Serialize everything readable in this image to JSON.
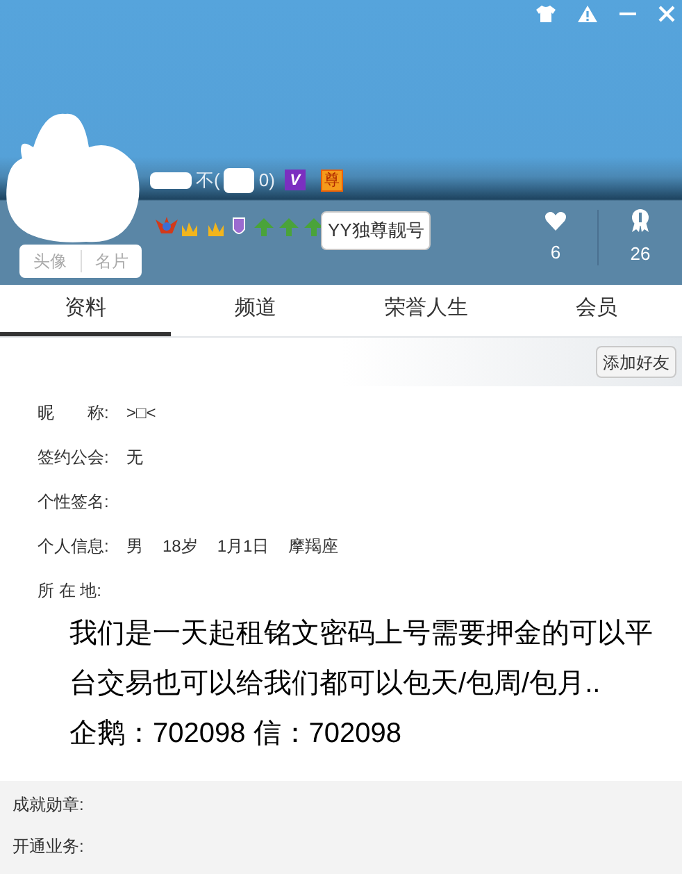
{
  "profile": {
    "name_fragments": [
      "不(",
      "0)"
    ],
    "vip_badge": "V",
    "honor_badge": "尊",
    "tooltip": "YY独尊靓号",
    "avatar_buttons": [
      "头像",
      "名片"
    ],
    "stats": [
      {
        "kind": "heart",
        "value": "6"
      },
      {
        "kind": "ribbon",
        "value": "26"
      }
    ]
  },
  "tabs": [
    {
      "label": "资料",
      "selected": true
    },
    {
      "label": "频道",
      "selected": false
    },
    {
      "label": "荣誉人生",
      "selected": false
    },
    {
      "label": "会员",
      "selected": false
    }
  ],
  "add_friend_button": "添加好友",
  "info": [
    {
      "label": "昵　　称:",
      "values": [
        ">□<"
      ]
    },
    {
      "label": "签约公会:",
      "values": [
        "无"
      ]
    },
    {
      "label": "个性签名:"
    },
    {
      "label": "个人信息:",
      "values": [
        "男",
        "18岁",
        "1月1日",
        "摩羯座"
      ]
    },
    {
      "label": "所 在 地:"
    }
  ],
  "message": [
    "我们是一天起租铭文密码上号需要押金的可以平台交易也可以给我们都可以包天/包周/包月..",
    "企鹅：702098  信：702098"
  ],
  "footer": [
    "成就勋章:",
    "开通业务:"
  ]
}
